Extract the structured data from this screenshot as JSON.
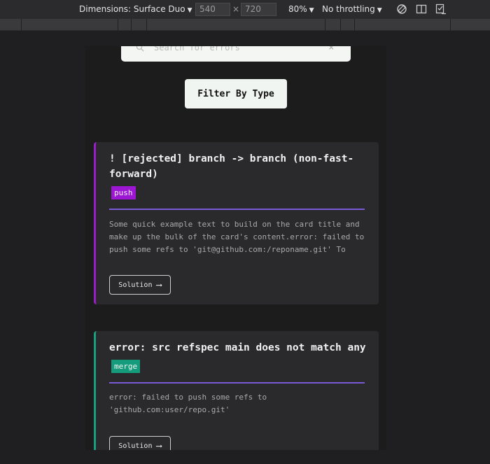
{
  "devtools": {
    "dimensions_label": "Dimensions: Surface Duo",
    "width_value": "540",
    "times": "×",
    "height_value": "720",
    "zoom": "80%",
    "throttling": "No throttling",
    "caret": "▼"
  },
  "search": {
    "placeholder": "Search for errors",
    "clear": "×"
  },
  "filter": {
    "label": "Filter By Type"
  },
  "cards": [
    {
      "title": "! [rejected] branch -> branch (non-fast-forward)",
      "tag": "push",
      "tag_color": "#9c16d4",
      "accent_color": "#9c1cc8",
      "body": "Some quick example text to build on the card title and make up the bulk of the card's content.error: failed to push some refs to 'git@github.com:/reponame.git' To",
      "button": "Solution",
      "arrow": "⟶"
    },
    {
      "title": "error: src refspec main does not match any",
      "tag": "merge",
      "tag_color": "#159c7d",
      "accent_color": "#17a181",
      "body": "error: failed to push some refs to 'github.com:user/repo.git'",
      "button": "Solution",
      "arrow": "⟶"
    }
  ]
}
